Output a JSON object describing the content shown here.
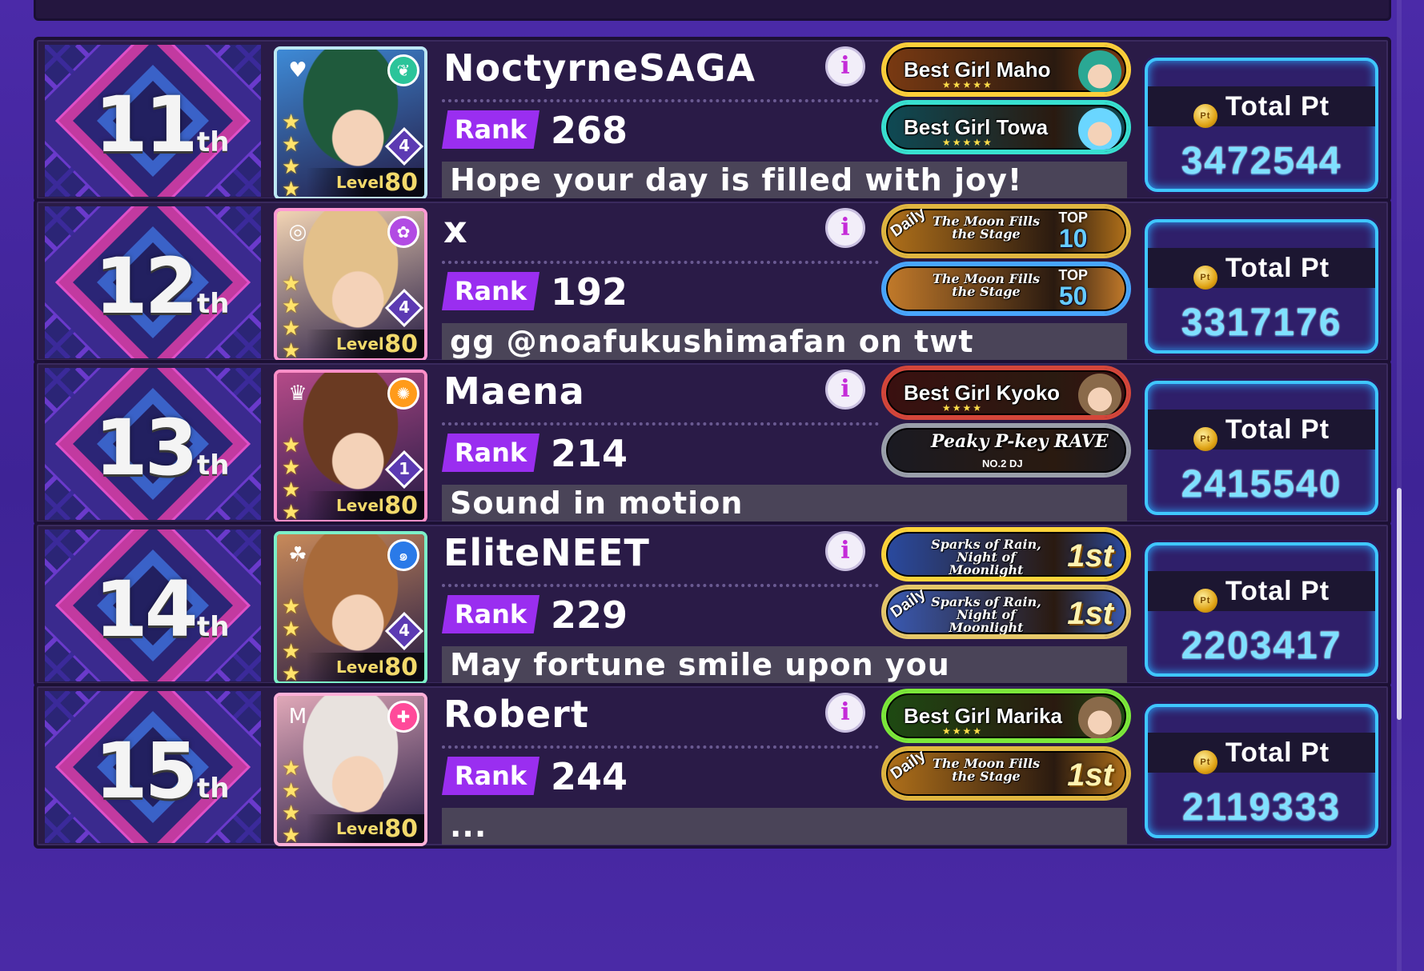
{
  "leaderboard": {
    "rank_tag_label": "Rank",
    "level_label": "Level",
    "total_pt_label": "Total Pt",
    "coin_label": "Pt",
    "info_label": "i",
    "entries": [
      {
        "place": "11",
        "suffix": "th",
        "name": "NoctyrneSAGA",
        "rank": "268",
        "comment": "Hope your day is filled with joy!",
        "total_pt": "3472544",
        "card": {
          "level": "80",
          "train": "4",
          "attribute_icon": "pure-leaf-icon",
          "attr_color": "#2bc49a",
          "band_icon": "heart-shield-icon",
          "frame_color": "#bde8f5",
          "hair_color": "#1f5a3c",
          "bg_color": "#3e8ad6",
          "stars": 5
        },
        "badges": [
          {
            "kind": "best_girl",
            "text": "Best Girl Maho",
            "stars": "★★★★★",
            "border": "#ffcf3a",
            "bg": "#7a3a12",
            "portrait": "#2aa894"
          },
          {
            "kind": "best_girl",
            "text": "Best Girl Towa",
            "stars": "★★★★★",
            "border": "#38e0d0",
            "bg": "#0e4a55",
            "portrait": "#6ad6ff"
          }
        ]
      },
      {
        "place": "12",
        "suffix": "th",
        "name": "x",
        "rank": "192",
        "comment": "gg @noafukushimafan on twt",
        "total_pt": "3317176",
        "card": {
          "level": "80",
          "train": "4",
          "attribute_icon": "happy-sneaker-icon",
          "attr_color": "#b24be3",
          "band_icon": "target-icon",
          "frame_color": "#ff9ad4",
          "hair_color": "#e3c08a",
          "bg_color": "#f2d4b4",
          "stars": 5
        },
        "badges": [
          {
            "kind": "event_top",
            "daily": "Daily",
            "event": "The Moon Fills the Stage",
            "top_label": "TOP",
            "top_num": "10",
            "border": "#e0b640",
            "bg": "#b0701a"
          },
          {
            "kind": "event_top",
            "daily": "",
            "event": "The Moon Fills the Stage",
            "top_label": "TOP",
            "top_num": "50",
            "border": "#48a6ff",
            "bg": "#c27a2a"
          }
        ]
      },
      {
        "place": "13",
        "suffix": "th",
        "name": "Maena",
        "rank": "214",
        "comment": "Sound in motion",
        "total_pt": "2415540",
        "card": {
          "level": "80",
          "train": "1",
          "attribute_icon": "cool-sun-icon",
          "attr_color": "#ff9b1a",
          "band_icon": "crown-icon",
          "frame_color": "#ff8fc8",
          "hair_color": "#6a3a22",
          "bg_color": "#b44a88",
          "stars": 4
        },
        "badges": [
          {
            "kind": "best_girl",
            "text": "Best Girl Kyoko",
            "stars": "★★★★",
            "border": "#d4463a",
            "bg": "#3a1010",
            "portrait": "#8a6a4a"
          },
          {
            "kind": "title",
            "text": "Peaky P-key RAVE",
            "sub": "NO.2 DJ",
            "border": "#9aa0aa",
            "bg": "#1a1a22"
          }
        ]
      },
      {
        "place": "14",
        "suffix": "th",
        "name": "EliteNEET",
        "rank": "229",
        "comment": "May fortune smile upon you",
        "total_pt": "2203417",
        "card": {
          "level": "80",
          "train": "4",
          "attribute_icon": "cool-swirl-icon",
          "attr_color": "#2a7ae8",
          "band_icon": "clover-icon",
          "frame_color": "#7cf0c8",
          "hair_color": "#a86a3a",
          "bg_color": "#c88a5a",
          "stars": 4
        },
        "badges": [
          {
            "kind": "event_first",
            "daily": "",
            "event": "Sparks of Rain, Night of Moonlight",
            "place": "1st",
            "border": "#ffd43a",
            "bg": "#2a4aa0"
          },
          {
            "kind": "event_first",
            "daily": "Daily",
            "event": "Sparks of Rain, Night of Moonlight",
            "place": "1st",
            "border": "#e6c86a",
            "bg": "#3a5ab4"
          }
        ]
      },
      {
        "place": "15",
        "suffix": "th",
        "name": "Robert",
        "rank": "244",
        "comment": "...",
        "total_pt": "2119333",
        "card": {
          "level": "80",
          "train": "",
          "attribute_icon": "happy-ribbon-icon",
          "attr_color": "#ff4a9a",
          "band_icon": "m-logo-icon",
          "frame_color": "#ffb0d8",
          "hair_color": "#e8e2de",
          "bg_color": "#e0a8b8",
          "stars": 5
        },
        "badges": [
          {
            "kind": "best_girl",
            "text": "Best Girl Marika",
            "stars": "★★★★",
            "border": "#7ce83a",
            "bg": "#1e4a12",
            "portrait": "#8a6a4a"
          },
          {
            "kind": "event_first",
            "daily": "Daily",
            "event": "The Moon Fills the Stage",
            "place": "1st",
            "border": "#e0b640",
            "bg": "#b0701a"
          }
        ]
      }
    ]
  }
}
